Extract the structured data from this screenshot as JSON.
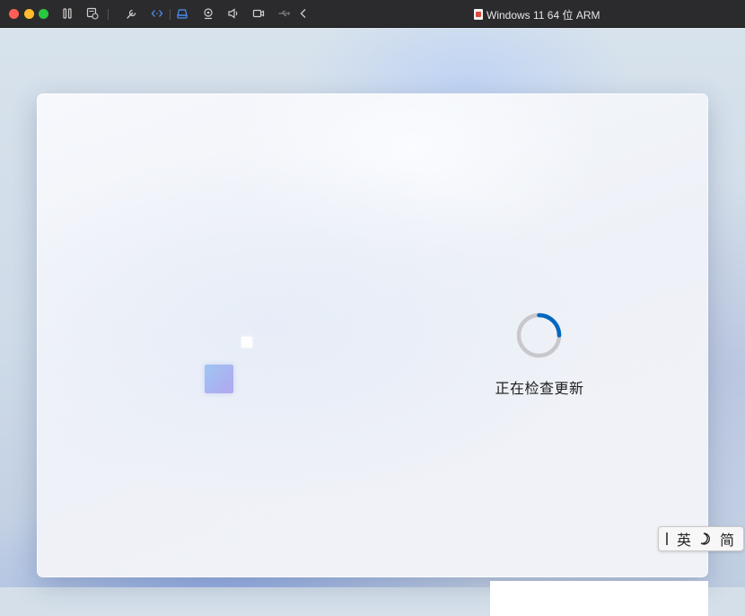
{
  "window": {
    "title": "Windows 11 64 位 ARM"
  },
  "toolbar": {
    "icons": [
      "pause-icon",
      "snapshot-icon",
      "settings-wrench-icon",
      "code-arrows-icon",
      "disk-drive-icon",
      "camera-webcam-icon",
      "speaker-icon",
      "video-camera-icon",
      "usb-icon",
      "chevron-left-icon"
    ]
  },
  "setup": {
    "status": "正在检查更新"
  },
  "ime": {
    "language": "英",
    "mode": "简"
  },
  "colors": {
    "spinner_active": "#0067c0",
    "spinner_track": "#c8c8cc",
    "titlebar": "#2b2b2d"
  }
}
